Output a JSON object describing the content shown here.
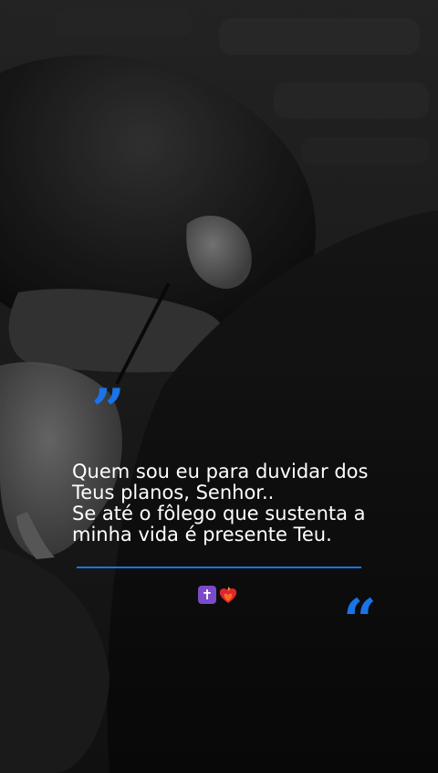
{
  "caption": {
    "lines": [
      "Quem sou eu para duvidar dos",
      "Teus planos, Senhor..",
      "Se até o fôlego que sustenta a",
      "minha vida é presente Teu."
    ]
  },
  "decor": {
    "quote_top": "”",
    "quote_bottom": "“",
    "cross_glyph": "✝"
  },
  "icons": {
    "cross": "latin-cross-emoji-icon",
    "heart": "heart-on-fire-emoji-icon"
  },
  "colors": {
    "accent": "#1a73e8",
    "cross_bg": "#7b4ac9",
    "heart": "#e0242f",
    "flame": "#ff8a1c",
    "text": "#ffffff"
  }
}
